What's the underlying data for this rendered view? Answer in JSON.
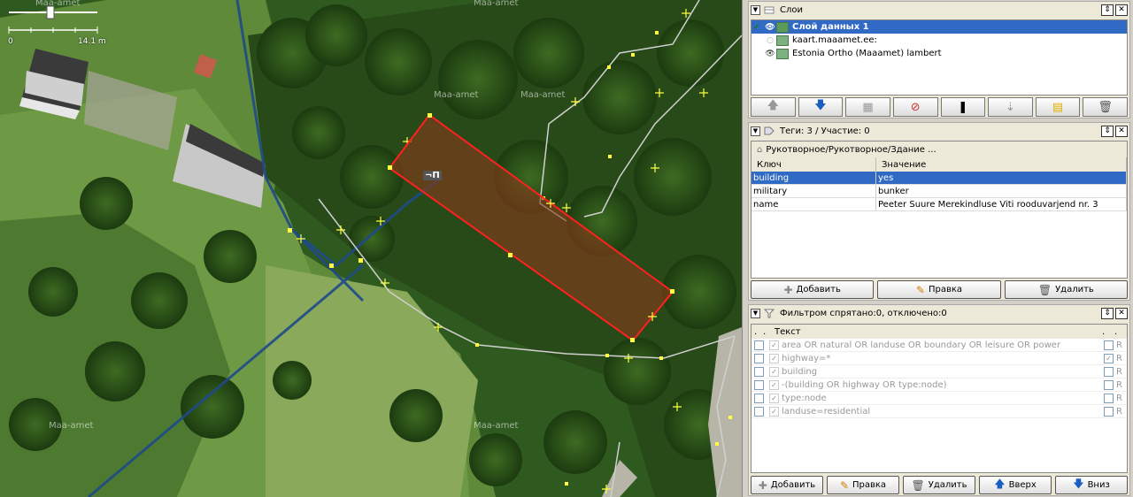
{
  "map": {
    "watermark": "Maa-amet",
    "scale": {
      "zero": "0",
      "distance": "14.1 m"
    },
    "object_label": "¬П",
    "colors": {
      "selection": "#ff2020",
      "fill": "#8b3a1a",
      "road": "#1f4a8a",
      "path": "#cfcfcf",
      "node": "#ffff40"
    }
  },
  "layers": {
    "title": "Слои",
    "items": [
      {
        "name": "Слой данных 1",
        "selected": true
      },
      {
        "name": "kaart.maaamet.ee:"
      },
      {
        "name": "Estonia Ortho (Maaamet) lambert"
      }
    ]
  },
  "tags": {
    "title": "Теги: 3 / Участие: 0",
    "preset": "Рукотворное/Рукотворное/Здание ...",
    "col_key": "Ключ",
    "col_value": "Значение",
    "rows": [
      {
        "key": "building",
        "value": "yes"
      },
      {
        "key": "military",
        "value": "bunker"
      },
      {
        "key": "name",
        "value": "Peeter Suure Merekindluse Viti rooduvarjend nr. 3"
      }
    ],
    "add": "Добавить",
    "edit": "Правка",
    "delete": "Удалить"
  },
  "filter": {
    "title": "Фильтром спрятано:0, отключено:0",
    "col_text": "Текст",
    "rows": [
      {
        "text": "area OR natural OR landuse OR boundary OR leisure OR power",
        "r": "R",
        "checked": false
      },
      {
        "text": "highway=*",
        "r": "R",
        "checked": true
      },
      {
        "text": "building",
        "r": "R",
        "checked": false
      },
      {
        "text": "-(building OR highway OR type:node)",
        "r": "R",
        "checked": false
      },
      {
        "text": "type:node",
        "r": "R",
        "checked": false
      },
      {
        "text": "landuse=residential",
        "r": "R",
        "checked": false
      }
    ],
    "add": "Добавить",
    "edit": "Правка",
    "delete": "Удалить",
    "up": "Вверх",
    "down": "Вниз"
  }
}
